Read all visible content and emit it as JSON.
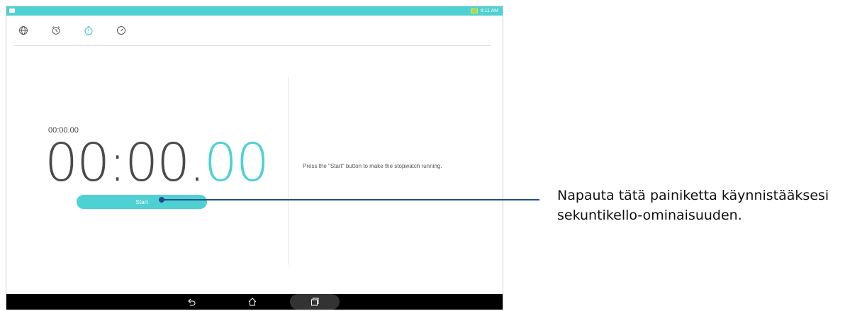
{
  "status_bar": {
    "time": "6:11 AM"
  },
  "tabs": [
    {
      "name": "world-clock",
      "active": false
    },
    {
      "name": "alarm",
      "active": false
    },
    {
      "name": "stopwatch",
      "active": true
    },
    {
      "name": "timer",
      "active": false
    }
  ],
  "stopwatch": {
    "small_time": "00:00.00",
    "big_time_main": "00:00.",
    "big_time_ms": "00",
    "start_label": "Start",
    "hint": "Press the \"Start\" button to make the stopwatch running."
  },
  "callout": {
    "text_line1": "Napauta tätä painiketta käynnistääksesi",
    "text_line2": "sekuntikello-ominaisuuden."
  },
  "colors": {
    "accent": "#4fd1d3",
    "callout": "#1d4e89"
  }
}
